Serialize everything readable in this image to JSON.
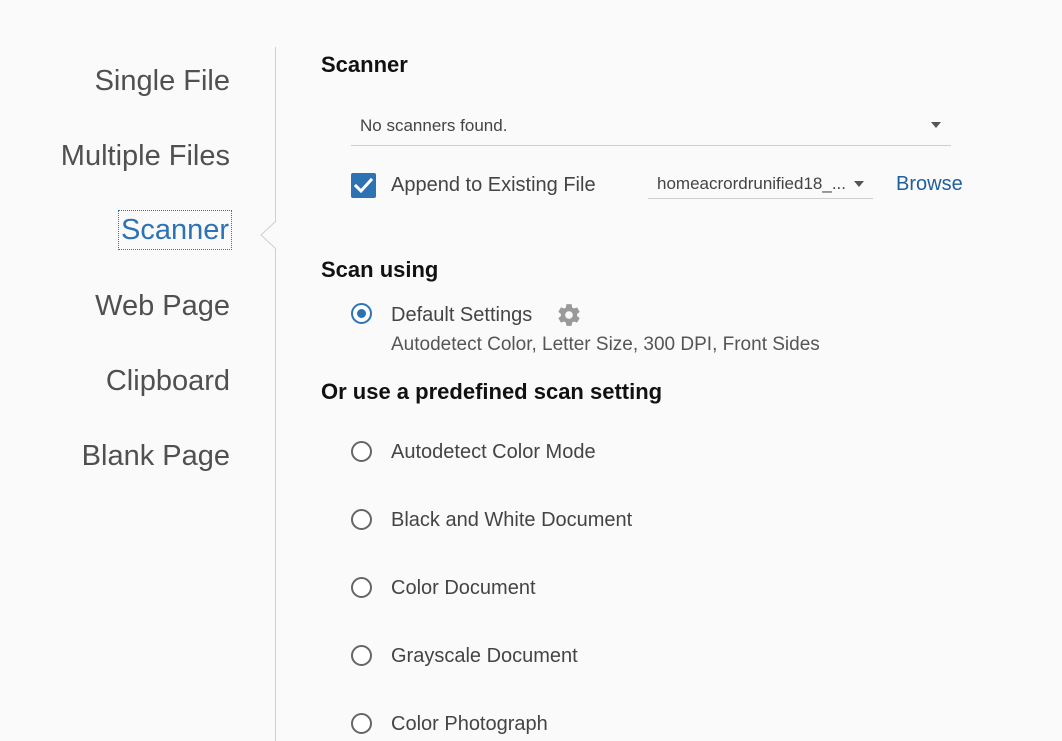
{
  "nav": {
    "items": [
      {
        "label": "Single File"
      },
      {
        "label": "Multiple Files"
      },
      {
        "label": "Scanner"
      },
      {
        "label": "Web Page"
      },
      {
        "label": "Clipboard"
      },
      {
        "label": "Blank Page"
      }
    ],
    "active": "Scanner"
  },
  "scanner": {
    "heading": "Scanner",
    "device_select": "No scanners found.",
    "append_checked": true,
    "append_label": "Append to Existing File",
    "file_select": "homeacrordrunified18_...",
    "browse_label": "Browse"
  },
  "scan_using": {
    "heading": "Scan using",
    "default_label": "Default Settings",
    "default_checked": true,
    "default_description": "Autodetect Color, Letter Size, 300 DPI, Front Sides"
  },
  "predefined": {
    "heading": "Or use a predefined scan setting",
    "options": [
      {
        "label": "Autodetect Color Mode"
      },
      {
        "label": "Black and White Document"
      },
      {
        "label": "Color Document"
      },
      {
        "label": "Grayscale Document"
      },
      {
        "label": "Color Photograph"
      }
    ]
  },
  "colors": {
    "accent": "#2d73b4",
    "link": "#1f5f9f",
    "nav_text": "#505050"
  }
}
